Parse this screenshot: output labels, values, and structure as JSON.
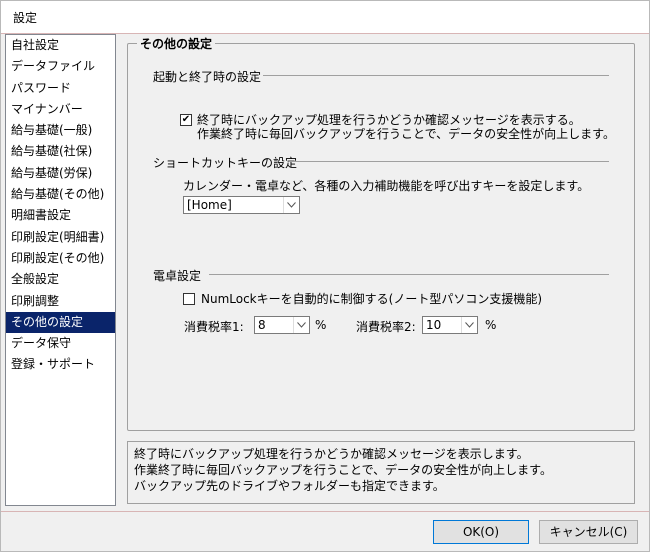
{
  "window": {
    "title": "設定"
  },
  "sidebar": {
    "items": [
      {
        "label": "自社設定"
      },
      {
        "label": "データファイル"
      },
      {
        "label": "パスワード"
      },
      {
        "label": "マイナンバー"
      },
      {
        "label": "給与基礎(一般)"
      },
      {
        "label": "給与基礎(社保)"
      },
      {
        "label": "給与基礎(労保)"
      },
      {
        "label": "給与基礎(その他)"
      },
      {
        "label": "明細書設定"
      },
      {
        "label": "印刷設定(明細書)"
      },
      {
        "label": "印刷設定(その他)"
      },
      {
        "label": "全般設定"
      },
      {
        "label": "印刷調整"
      },
      {
        "label": "その他の設定",
        "selected": true
      },
      {
        "label": "データ保守"
      },
      {
        "label": "登録・サポート"
      }
    ]
  },
  "panel": {
    "title": "その他の設定",
    "startup": {
      "title": "起動と終了時の設定",
      "backup_checked": true,
      "backup_label_line1": "終了時にバックアップ処理を行うかどうか確認メッセージを表示する。",
      "backup_label_line2": "作業終了時に毎回バックアップを行うことで、データの安全性が向上します。"
    },
    "shortcut": {
      "title": "ショートカットキーの設定",
      "description": "カレンダー・電卓など、各種の入力補助機能を呼び出すキーを設定します。",
      "key_value": "[Home]"
    },
    "calculator": {
      "title": "電卓設定",
      "numlock_checked": false,
      "numlock_label": "NumLockキーを自動的に制御する(ノート型パソコン支援機能)",
      "tax1_label": "消費税率1:",
      "tax1_value": "8",
      "tax2_label": "消費税率2:",
      "tax2_value": "10",
      "percent": "%"
    }
  },
  "status": {
    "line1": "終了時にバックアップ処理を行うかどうか確認メッセージを表示します。",
    "line2": "作業終了時に毎回バックアップを行うことで、データの安全性が向上します。",
    "line3": "バックアップ先のドライブやフォルダーも指定できます。"
  },
  "buttons": {
    "ok": "OK(O)",
    "cancel": "キャンセル(C)"
  }
}
